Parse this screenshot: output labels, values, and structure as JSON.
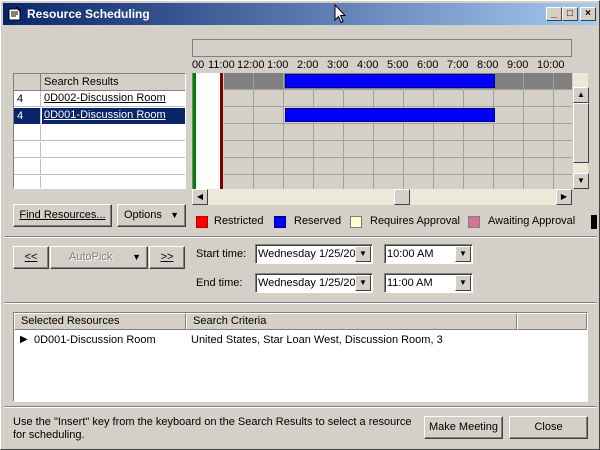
{
  "window": {
    "title": "Resource Scheduling",
    "controls": {
      "minimize": "_",
      "maximize": "□",
      "close": "×"
    }
  },
  "search_results": {
    "header": "Search Results",
    "rows": [
      {
        "num": "4",
        "name": "0D002-Discussion Room",
        "selected": false
      },
      {
        "num": "4",
        "name": "0D001-Discussion Room",
        "selected": true
      },
      {
        "num": "",
        "name": ""
      },
      {
        "num": "",
        "name": ""
      },
      {
        "num": "",
        "name": ""
      },
      {
        "num": "",
        "name": ""
      }
    ]
  },
  "schedule": {
    "hours": [
      "00",
      "11:00",
      "12:00",
      "1:00",
      "2:00",
      "3:00",
      "4:00",
      "5:00",
      "6:00",
      "7:00",
      "8:00",
      "9:00",
      "10:00"
    ],
    "bars": [
      {
        "row": 0,
        "from": "2:00",
        "to": "9:00",
        "color": "#0000ff"
      },
      {
        "row": 2,
        "from": "2:00",
        "to": "9:00",
        "color": "#0000ff"
      }
    ]
  },
  "buttons": {
    "find_resources": "Find Resources...",
    "options": "Options",
    "prev": "<<",
    "autopick": "AutoPick",
    "next": ">>",
    "make_meeting": "Make Meeting",
    "close": "Close"
  },
  "legend": [
    {
      "label": "Restricted",
      "color": "#ff0000"
    },
    {
      "label": "Reserved",
      "color": "#0000ff"
    },
    {
      "label": "Requires Approval",
      "color": "#ffffcc"
    },
    {
      "label": "Awaiting Approval",
      "color": "#d87093"
    }
  ],
  "time": {
    "start_label": "Start time:",
    "start_date": "Wednesday 1/25/20",
    "start_time": "10:00 AM",
    "end_label": "End time:",
    "end_date": "Wednesday 1/25/20",
    "end_time": "11:00 AM"
  },
  "selected_resources": {
    "columns": [
      "Selected Resources",
      "Search Criteria"
    ],
    "rows": [
      {
        "resource": "0D001-Discussion Room",
        "criteria": "United States, Star Loan West, Discussion Room, 3"
      }
    ]
  },
  "footer": {
    "hint": "Use the \"Insert\" key from the keyboard on the Search Results to select a resource for scheduling."
  },
  "colors": {
    "title_gradient_start": "#0a246a",
    "title_gradient_end": "#a6caf0",
    "reserved": "#0000ff",
    "current_time": "#800000",
    "now_marker": "#008000"
  }
}
